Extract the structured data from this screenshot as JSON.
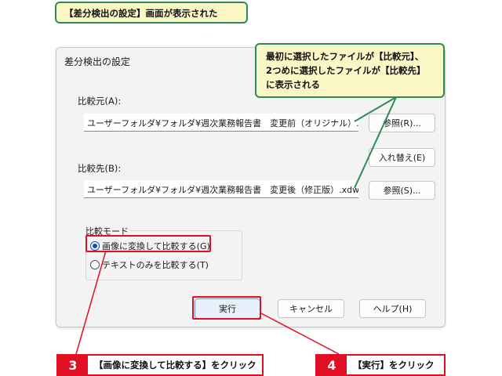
{
  "top_callout": {
    "text": "【差分検出の設定】画面が表示された"
  },
  "right_callout": {
    "line1": "最初に選択したファイルが【比較元】、",
    "line2": "2つめに選択したファイルが【比較先】",
    "line3": "に表示される"
  },
  "dialog": {
    "title": "差分検出の設定",
    "source_label": "比較元(A):",
    "source_path": "ユーザーフォルダ¥フォルダ¥週次業務報告書　変更前（オリジナル）.xdw",
    "source_browse": "参照(R)...",
    "swap_button": "入れ替え(E)",
    "target_label": "比較先(B):",
    "target_path": "ユーザーフォルダ¥フォルダ¥週次業務報告書　変更後（修正版）.xdw",
    "target_browse": "参照(S)...",
    "mode_group_title": "比較モード",
    "mode_image": "画像に変換して比較する(G)",
    "mode_text": "テキストのみを比較する(T)",
    "execute_button": "実行",
    "cancel_button": "キャンセル",
    "help_button": "ヘルプ(H)"
  },
  "steps": [
    {
      "number": "3",
      "text": "【画像に変換して比較する】をクリック"
    },
    {
      "number": "4",
      "text": "【実行】をクリック"
    }
  ],
  "colors": {
    "callout_bg": "#fbf7c7",
    "callout_border": "#2e8b57",
    "step_red": "#e10f23",
    "radio_blue": "#0a4fb5"
  }
}
